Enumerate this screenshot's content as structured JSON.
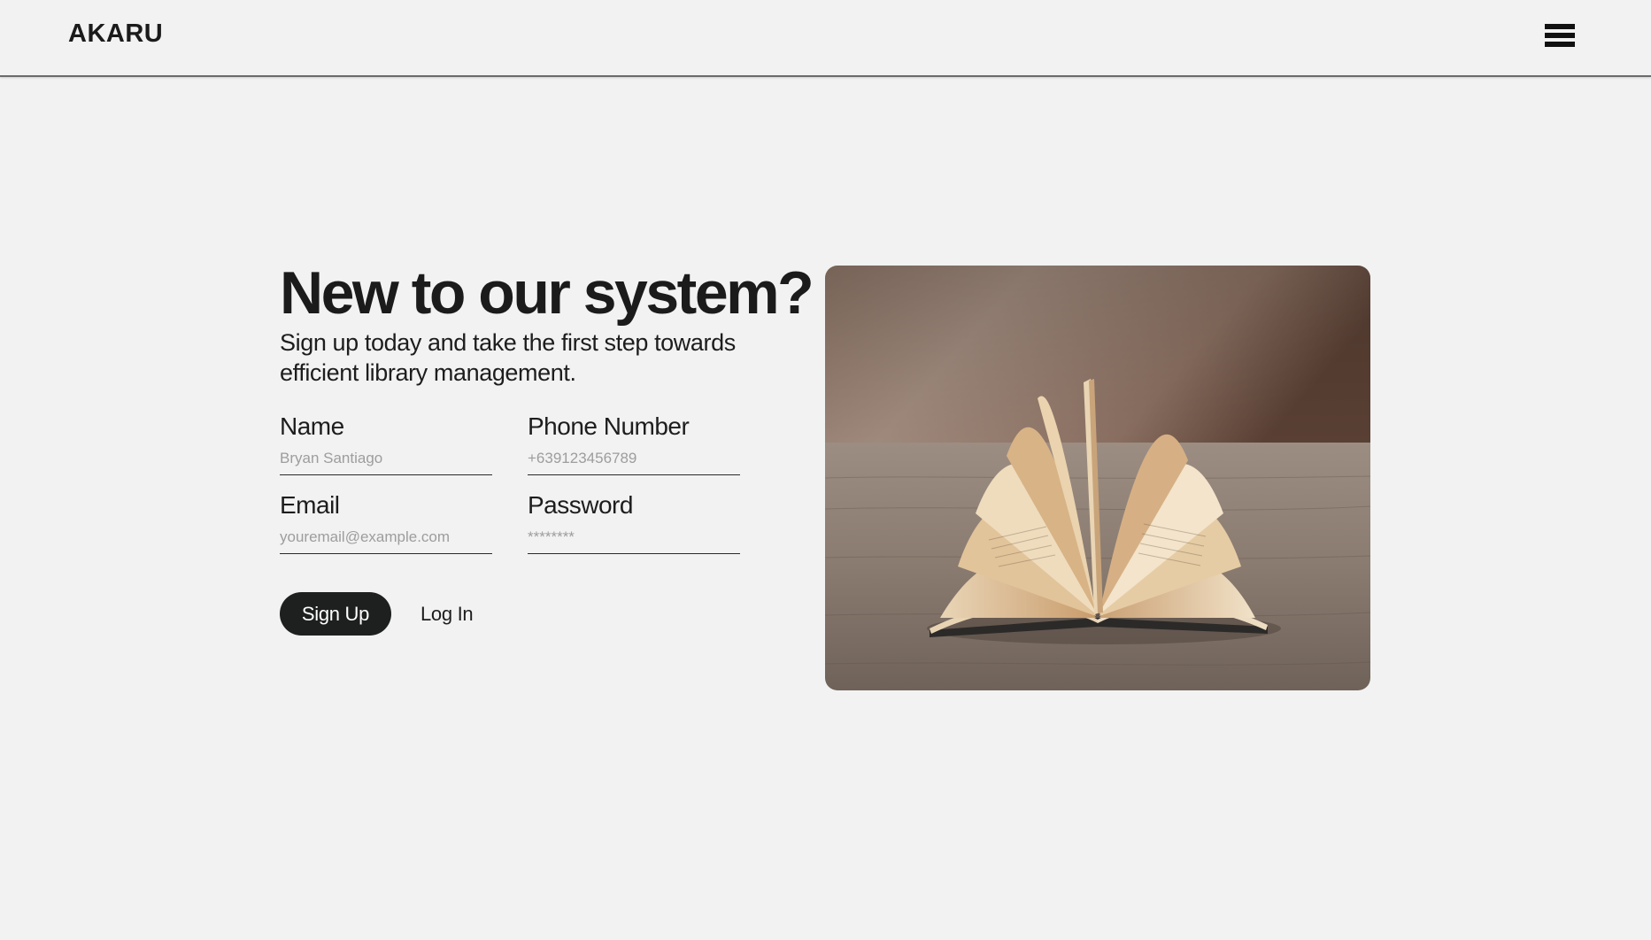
{
  "header": {
    "brand": "AKARU",
    "menu_icon": "hamburger-menu-icon"
  },
  "hero": {
    "title": "New to our system?",
    "subtitle": "Sign up today and take the first step towards efficient library management."
  },
  "form": {
    "name": {
      "label": "Name",
      "placeholder": "Bryan Santiago"
    },
    "phone": {
      "label": "Phone Number",
      "placeholder": "+639123456789"
    },
    "email": {
      "label": "Email",
      "placeholder": "youremail@example.com"
    },
    "password": {
      "label": "Password",
      "placeholder": "********"
    }
  },
  "actions": {
    "signup_label": "Sign Up",
    "login_label": "Log In"
  },
  "image": {
    "subject": "open-book-photo"
  },
  "colors": {
    "background": "#f1f2f1",
    "button_bg": "#1e1f1f",
    "button_text": "#ffffff",
    "text": "#1d1d1d",
    "placeholder": "#9d9d9d"
  }
}
